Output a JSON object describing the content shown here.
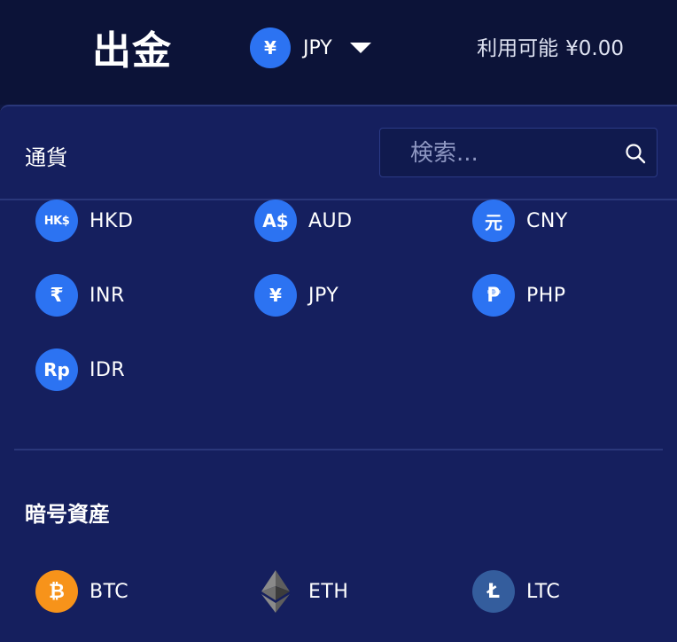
{
  "header": {
    "title": "出金",
    "selected_currency": {
      "symbol": "¥",
      "code": "JPY"
    },
    "balance_label": "利用可能",
    "balance_amount": "¥0.00"
  },
  "dropdown": {
    "fiat_label": "通貨",
    "search_placeholder": "検索...",
    "fiat": [
      {
        "symbol": "HK$",
        "code": "HKD"
      },
      {
        "symbol": "A$",
        "code": "AUD"
      },
      {
        "symbol": "元",
        "code": "CNY"
      },
      {
        "symbol": "₹",
        "code": "INR"
      },
      {
        "symbol": "¥",
        "code": "JPY"
      },
      {
        "symbol": "₱",
        "code": "PHP"
      },
      {
        "symbol": "Rp",
        "code": "IDR"
      }
    ],
    "crypto_label": "暗号資産",
    "crypto": [
      {
        "symbol": "₿",
        "code": "BTC",
        "icon": "bitcoin-icon",
        "color": "#f7931a"
      },
      {
        "symbol": "",
        "code": "ETH",
        "icon": "ethereum-icon",
        "color": "#8a8a8a"
      },
      {
        "symbol": "Ł",
        "code": "LTC",
        "icon": "litecoin-icon",
        "color": "#345d9d"
      }
    ]
  },
  "colors": {
    "accent": "#2c73f2",
    "background": "#0e1640",
    "panel": "#151f5e"
  }
}
